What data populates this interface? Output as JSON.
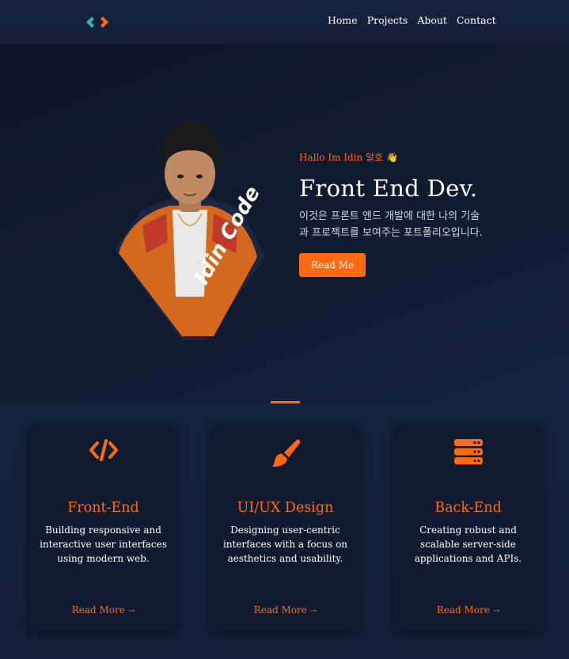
{
  "nav": {
    "logo_icon": "code-chevrons-icon",
    "links": [
      "Home",
      "Projects",
      "About",
      "Contact"
    ]
  },
  "hero": {
    "greeting": "Hallo Im Idin 알호 👋",
    "title": "Front End Dev.",
    "description": "이것은 프론트 엔드 개발에 대한 나의 기술과 프로젝트를 보여주는 포트폴리오입니다.",
    "button_label": "Read Me",
    "portrait_caption": "Idin Code"
  },
  "services": [
    {
      "icon": "code-icon",
      "title": "Front-End",
      "description": "Building responsive and interactive user interfaces using modern web.",
      "link_label": "Read More",
      "link_arrow": "→"
    },
    {
      "icon": "paintbrush-icon",
      "title": "UI/UX Design",
      "description": "Designing user-centric interfaces with a focus on aesthetics and usability.",
      "link_label": "Read More",
      "link_arrow": "→"
    },
    {
      "icon": "server-icon",
      "title": "Back-End",
      "description": "Creating robust and scalable server-side applications and APIs.",
      "link_label": "Read More",
      "link_arrow": "→"
    }
  ],
  "colors": {
    "accent": "#ff6a13",
    "logo_teal": "#2bb8a6",
    "background": "#0f1a2e"
  }
}
